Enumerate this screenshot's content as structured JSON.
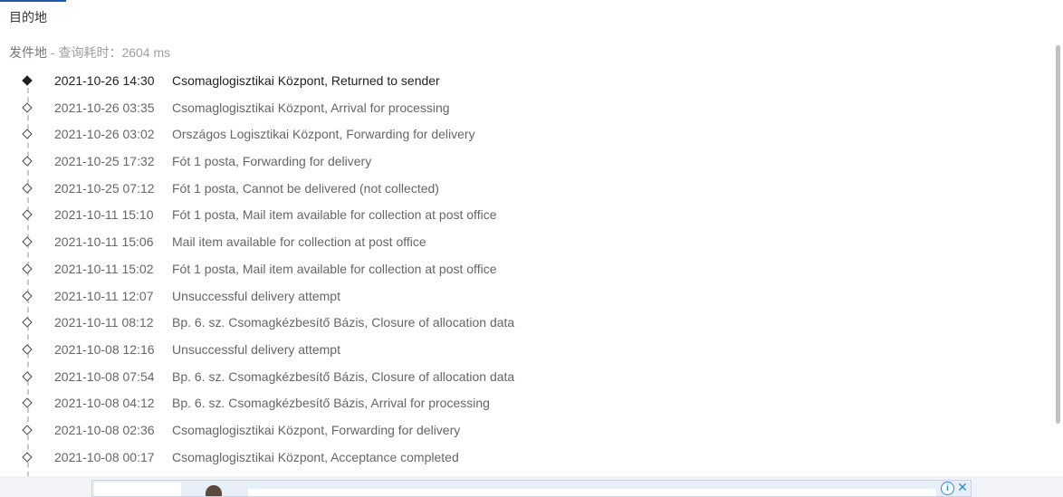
{
  "tabs": {
    "destination": "目的地"
  },
  "origin": {
    "label": "发件地",
    "separator": " - ",
    "query_time_label": "查询耗时：",
    "query_time": "2604 ms"
  },
  "events": [
    {
      "time": "2021-10-26 14:30",
      "desc": "Csomaglogisztikai Központ, Returned to sender"
    },
    {
      "time": "2021-10-26 03:35",
      "desc": "Csomaglogisztikai Központ, Arrival for processing"
    },
    {
      "time": "2021-10-26 03:02",
      "desc": "Országos Logisztikai Központ, Forwarding for delivery"
    },
    {
      "time": "2021-10-25 17:32",
      "desc": "Fót 1 posta, Forwarding for delivery"
    },
    {
      "time": "2021-10-25 07:12",
      "desc": "Fót 1 posta, Cannot be delivered (not collected)"
    },
    {
      "time": "2021-10-11 15:10",
      "desc": "Fót 1 posta, Mail item available for collection at post office"
    },
    {
      "time": "2021-10-11 15:06",
      "desc": "Mail item available for collection at post office"
    },
    {
      "time": "2021-10-11 15:02",
      "desc": "Fót 1 posta, Mail item available for collection at post office"
    },
    {
      "time": "2021-10-11 12:07",
      "desc": "Unsuccessful delivery attempt"
    },
    {
      "time": "2021-10-11 08:12",
      "desc": "Bp. 6. sz. Csomagkézbesítő Bázis, Closure of allocation data"
    },
    {
      "time": "2021-10-08 12:16",
      "desc": "Unsuccessful delivery attempt"
    },
    {
      "time": "2021-10-08 07:54",
      "desc": "Bp. 6. sz. Csomagkézbesítő Bázis, Closure of allocation data"
    },
    {
      "time": "2021-10-08 04:12",
      "desc": "Bp. 6. sz. Csomagkézbesítő Bázis, Arrival for processing"
    },
    {
      "time": "2021-10-08 02:36",
      "desc": "Csomaglogisztikai Központ, Forwarding for delivery"
    },
    {
      "time": "2021-10-08 00:17",
      "desc": "Csomaglogisztikai Központ, Acceptance completed"
    }
  ],
  "ad": {
    "info_icon": "info-icon",
    "close_icon": "close-icon",
    "info_glyph": "i",
    "close_glyph": "✕"
  },
  "colors": {
    "accent": "#1e5aa8",
    "current_event": "#222222",
    "event_text": "#666666"
  }
}
